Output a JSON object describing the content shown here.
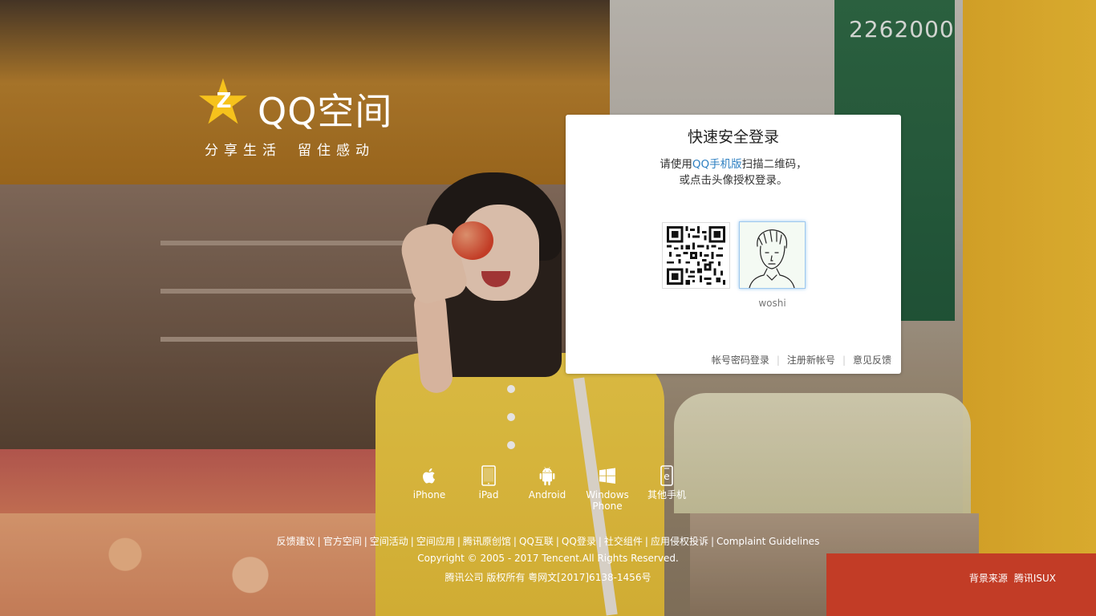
{
  "logo": {
    "title": "QQ空间",
    "slogan_left": "分享生活",
    "slogan_right": "留住感动",
    "star_letter": "Z",
    "star_color": "#f6c21c"
  },
  "login": {
    "title": "快速安全登录",
    "desc_prefix": "请使用",
    "desc_link": "QQ手机版",
    "desc_suffix": "扫描二维码，",
    "desc_line2": "或点击头像授权登录。",
    "avatar_name": "woshi",
    "links": [
      "帐号密码登录",
      "注册新帐号",
      "意见反馈"
    ],
    "link_color": "#2d7fc1"
  },
  "downloads": [
    {
      "label": "iPhone",
      "icon": "apple-icon"
    },
    {
      "label": "iPad",
      "icon": "tablet-icon"
    },
    {
      "label": "Android",
      "icon": "android-icon"
    },
    {
      "label": "Windows Phone",
      "icon": "windows-icon"
    },
    {
      "label": "其他手机",
      "icon": "phone-icon"
    }
  ],
  "footer": {
    "links": [
      "反馈建议",
      "官方空间",
      "空间活动",
      "空间应用",
      "腾讯原创馆",
      "QQ互联",
      "QQ登录",
      "社交组件",
      "应用侵权投诉",
      "Complaint Guidelines"
    ],
    "copyright": "Copyright © 2005 - 2017 Tencent.All Rights Reserved.",
    "icp": "腾讯公司 版权所有 粤网文[2017]6138-1456号",
    "bg_source_label": "背景来源",
    "bg_source_link": "腾讯ISUX"
  },
  "background": {
    "sign_number": "2262000"
  }
}
